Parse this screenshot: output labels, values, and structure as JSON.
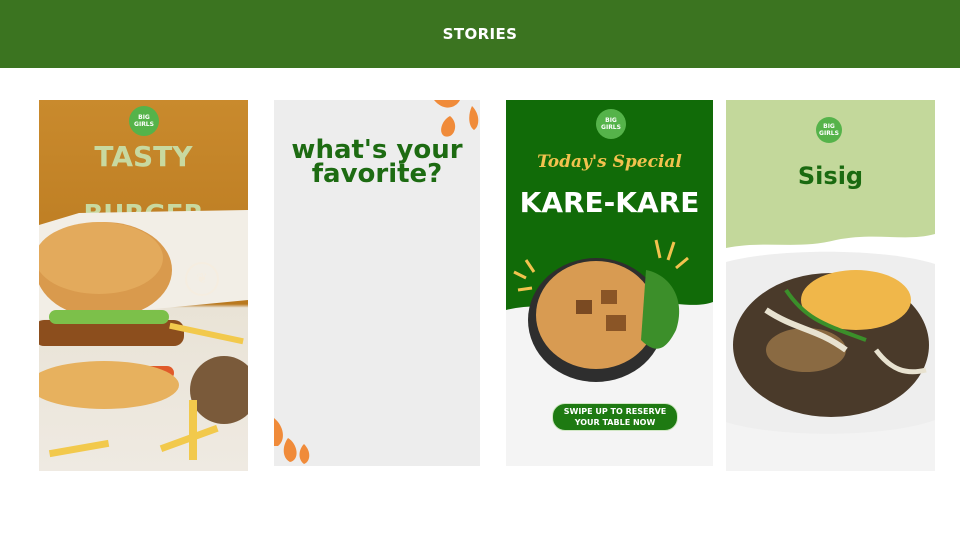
{
  "header": {
    "title": "STORIES"
  },
  "colors": {
    "header": "#3b7420",
    "brand_green": "#55b34a",
    "orange": "#f08b3a"
  },
  "stories": [
    {
      "logo_text": "BIG GIRLS",
      "line1": "TASTY",
      "line2": "BURGER",
      "icon": "plant-based-badge-icon"
    },
    {
      "title": "what's your favorite?"
    },
    {
      "logo_text": "BIG GIRLS",
      "subtitle": "Today's Special",
      "title": "KARE-KARE",
      "cta_line1": "SWIPE UP TO RESERVE",
      "cta_line2": "YOUR TABLE NOW"
    },
    {
      "logo_text": "BIG GIRLS",
      "title": "Sisig"
    }
  ]
}
